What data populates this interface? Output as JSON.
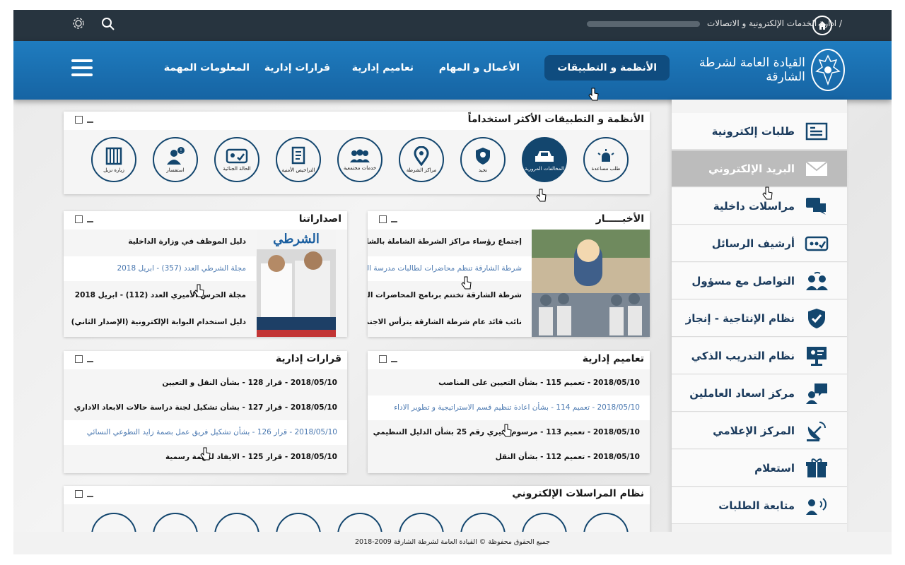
{
  "topbar": {
    "breadcrumb_current": "/ ادارة الخدمات الإلكترونية و الاتصالات",
    "icons": [
      "home-icon",
      "gear-icon",
      "search-icon"
    ]
  },
  "header": {
    "logo_text": "القيادة العامة لشرطة الشارقة",
    "nav": [
      {
        "label": "الأنظمة و التطبيقات",
        "active": true
      },
      {
        "label": "الأعمال و المهام"
      },
      {
        "label": "تعاميم إدارية"
      },
      {
        "label": "قرارات إدارية"
      },
      {
        "label": "المعلومات المهمة"
      }
    ]
  },
  "apps_panel": {
    "title": "الأنظمة و التطبيقات الأكثر استخداماً",
    "apps": [
      {
        "label": "طلب مساعدة",
        "icon": "alarm-icon"
      },
      {
        "label": "المخالفات المرورية",
        "icon": "car-icon"
      },
      {
        "label": "نجيد",
        "icon": "shield-user-icon"
      },
      {
        "label": "مراكز الشرطة",
        "icon": "location-icon"
      },
      {
        "label": "خدمات مجتمعية",
        "icon": "people-icon"
      },
      {
        "label": "التراخيص الأمنية",
        "icon": "document-icon"
      },
      {
        "label": "الحالة الجنائية",
        "icon": "id-card-icon"
      },
      {
        "label": "استفسار",
        "icon": "user-question-icon"
      },
      {
        "label": "زيارة نزيل",
        "icon": "prison-icon"
      }
    ]
  },
  "news": {
    "title": "الأخبـــــار",
    "items": [
      "إجتماع رؤساء مراكز الشرطة الشاملة بالشارقة",
      "شرطة الشارقة تنظم محاضرات لطالبات مدرسة النخيلات",
      "شرطة الشارقة تختتم برنامج المحاضرات التخصصية",
      "نائب قائد عام شرطة الشارقة يترأس الاجتماع الخامس"
    ]
  },
  "publications": {
    "title": "اصداراتنا",
    "magazine_title": "الشرطي",
    "items": [
      "دليل الموظف في وزارة الداخلية",
      "مجلة الشرطي العدد (357) - ابريل 2018",
      "مجلة الحرس الأميري العدد (112) - ابريل 2018",
      "دليل استخدام البوابة الإلكترونية (الإصدار الثاني)"
    ]
  },
  "circulars": {
    "title": "تعاميم إدارية",
    "items": [
      "2018/05/10 - تعميم 115 - بشأن التعيين على المناصب",
      "2018/05/10 - تعميم 114 - بشأن اعادة تنظيم قسم الاستراتيجية و تطوير الاداء",
      "2018/05/10 - تعميم 113 - مرسوم اميري رقم 25 بشأن الدليل التنظيمي",
      "2018/05/10 - تعميم 112 - بشأن النقل"
    ]
  },
  "decisions": {
    "title": "قرارات إدارية",
    "items": [
      "2018/05/10 - قرار 128 - بشأن النقل و التعيين",
      "2018/05/10 - قرار 127 - بشأن تشكيل لجنة دراسة حالات الابعاد الاداري",
      "2018/05/10 - قرار 126 - بشأن تشكيل فريق عمل بصمة زايد التطوعي النسائي",
      "2018/05/10 - قرار 125 - الايفاد لمهمة رسمية"
    ]
  },
  "messaging_panel": {
    "title": "نظام المراسلات الإلكتروني"
  },
  "sidebar": {
    "items": [
      {
        "label": "طلبات إلكترونية",
        "icon": "form-icon"
      },
      {
        "label": "البريد الإلكتروني",
        "icon": "envelope-icon",
        "active": true
      },
      {
        "label": "مراسلات داخلية",
        "icon": "chat-icon"
      },
      {
        "label": "أرشيف الرسائل",
        "icon": "archive-icon"
      },
      {
        "label": "التواصل مع مسؤول",
        "icon": "contact-icon"
      },
      {
        "label": "نظام الإنتاجية - إنجاز",
        "icon": "shield-check-icon"
      },
      {
        "label": "نظام التدريب الذكي",
        "icon": "training-icon"
      },
      {
        "label": "مركز اسعاد العاملين",
        "icon": "happiness-icon"
      },
      {
        "label": "المركز الإعلامي",
        "icon": "satellite-icon"
      },
      {
        "label": "استعلام",
        "icon": "query-icon"
      },
      {
        "label": "متابعة الطلبات",
        "icon": "tracking-icon"
      }
    ]
  },
  "footer": {
    "text": "جميع الحقوق محفوظة © القيادة العامة لشرطة الشارقة 2009-2018"
  },
  "colors": {
    "navy": "#13466e",
    "nav_blue": "#1a70b4",
    "topbar": "#27343f",
    "link": "#4a78b0"
  }
}
